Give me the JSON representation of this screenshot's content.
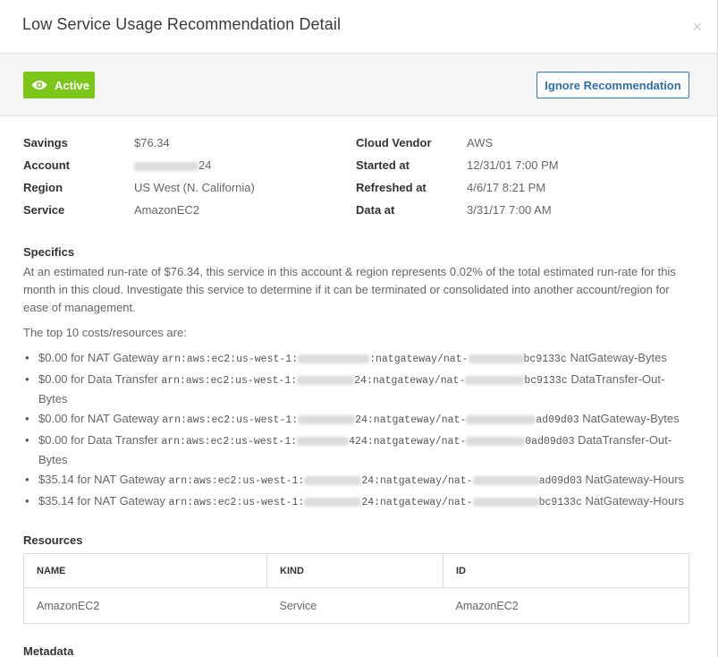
{
  "modal": {
    "title": "Low Service Usage Recommendation Detail",
    "close_label": "×"
  },
  "actions": {
    "status_label": "Active",
    "ignore_label": "Ignore Recommendation"
  },
  "details": {
    "left": [
      {
        "label": "Savings",
        "value": "$76.34"
      },
      {
        "label": "Account",
        "value": "24"
      },
      {
        "label": "Region",
        "value": "US West (N. California)"
      },
      {
        "label": "Service",
        "value": "AmazonEC2"
      }
    ],
    "right": [
      {
        "label": "Cloud Vendor",
        "value": "AWS"
      },
      {
        "label": "Started at",
        "value": "12/31/01 7:00 PM"
      },
      {
        "label": "Refreshed at",
        "value": "4/6/17 8:21 PM"
      },
      {
        "label": "Data at",
        "value": "3/31/17 7:00 AM"
      }
    ]
  },
  "specifics": {
    "title": "Specifics",
    "text": "At an estimated run-rate of $76.34, this service in this account & region represents 0.02% of the total estimated run-rate for this month in this cloud. Investigate this service to determine if it can be terminated or consolidated into another account/region for ease of management.",
    "top_label": "The top 10 costs/resources are:",
    "items": [
      {
        "cost": "$0.00 for NAT Gateway",
        "arn_prefix": "arn:aws:ec2:us-west-1:",
        "arn_mid": ":natgateway/nat-",
        "arn_suffix": "bc9133c",
        "usage": "NatGateway-Bytes"
      },
      {
        "cost": "$0.00 for Data Transfer",
        "arn_prefix": "arn:aws:ec2:us-west-1:",
        "arn_mid": "24:natgateway/nat-",
        "arn_suffix": "bc9133c",
        "usage": "DataTransfer-Out-Bytes"
      },
      {
        "cost": "$0.00 for NAT Gateway",
        "arn_prefix": "arn:aws:ec2:us-west-1:",
        "arn_mid": "24:natgateway/nat-",
        "arn_suffix": "ad09d03",
        "usage": "NatGateway-Bytes"
      },
      {
        "cost": "$0.00 for Data Transfer",
        "arn_prefix": "arn:aws:ec2:us-west-1:",
        "arn_mid": "424:natgateway/nat-",
        "arn_suffix": "0ad09d03",
        "usage": "DataTransfer-Out-Bytes"
      },
      {
        "cost": "$35.14 for NAT Gateway",
        "arn_prefix": "arn:aws:ec2:us-west-1:",
        "arn_mid": "24:natgateway/nat-",
        "arn_suffix": "ad09d03",
        "usage": "NatGateway-Hours"
      },
      {
        "cost": "$35.14 for NAT Gateway",
        "arn_prefix": "arn:aws:ec2:us-west-1:",
        "arn_mid": "24:natgateway/nat-",
        "arn_suffix": "bc9133c",
        "usage": "NatGateway-Hours"
      }
    ]
  },
  "resources": {
    "title": "Resources",
    "columns": [
      "NAME",
      "KIND",
      "ID"
    ],
    "rows": [
      [
        "AmazonEC2",
        "Service",
        "AmazonEC2"
      ]
    ]
  },
  "metadata": {
    "title": "Metadata"
  },
  "colors": {
    "active_green": "#7cc61a",
    "link_blue": "#2f6fad"
  },
  "icons": {
    "status": "eye-icon",
    "close": "close-icon"
  }
}
